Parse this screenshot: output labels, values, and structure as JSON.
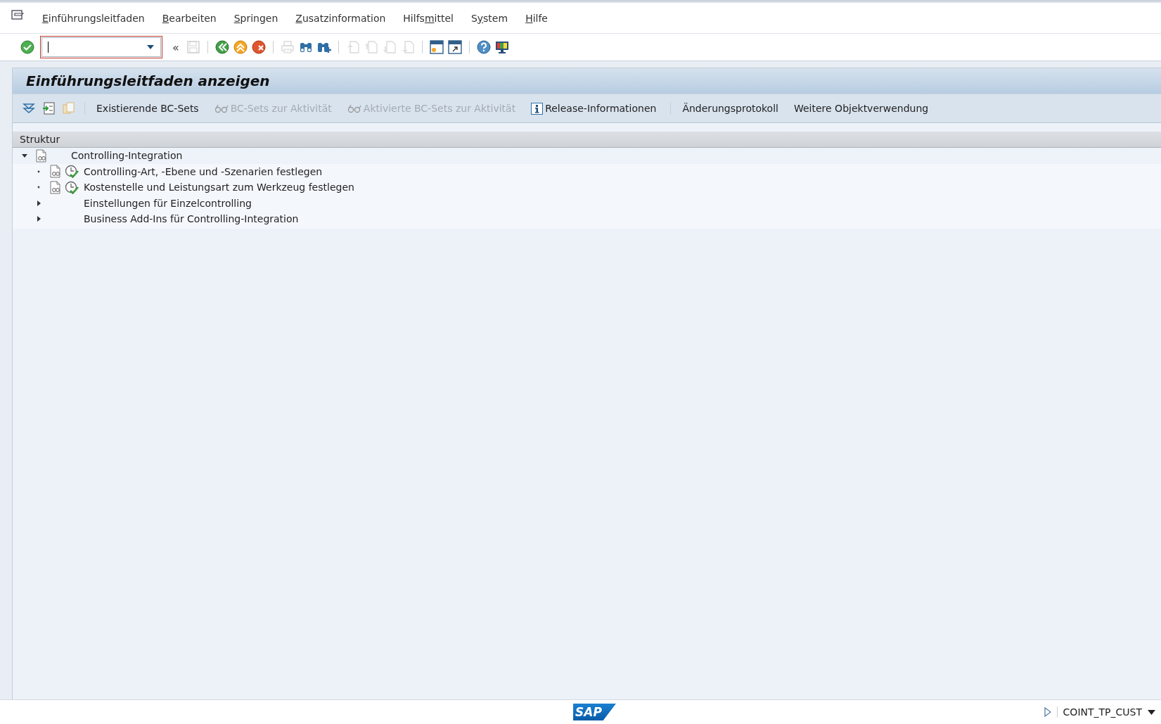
{
  "menu": [
    {
      "key": "E",
      "rest": "inführungsleitfaden"
    },
    {
      "key": "B",
      "rest": "earbeiten"
    },
    {
      "key": "S",
      "rest": "pringen"
    },
    {
      "key": "Z",
      "rest": "usatzinformation"
    },
    {
      "start": "Hilfs",
      "key": "m",
      "rest": "ittel"
    },
    {
      "start": "S",
      "key": "y",
      "rest": "stem"
    },
    {
      "key": "H",
      "rest": "ilfe"
    }
  ],
  "toolbar": [
    {
      "kind": "enter",
      "disabled": false
    },
    {
      "kind": "command"
    },
    {
      "kind": "history",
      "label": "«",
      "disabled": false
    },
    {
      "kind": "save",
      "disabled": true
    },
    {
      "kind": "sep"
    },
    {
      "kind": "back",
      "disabled": false
    },
    {
      "kind": "exit",
      "disabled": false
    },
    {
      "kind": "cancel",
      "disabled": false
    },
    {
      "kind": "sep"
    },
    {
      "kind": "print",
      "disabled": true
    },
    {
      "kind": "find",
      "disabled": false
    },
    {
      "kind": "findnext",
      "disabled": false
    },
    {
      "kind": "sep"
    },
    {
      "kind": "first",
      "disabled": true
    },
    {
      "kind": "prev",
      "disabled": true
    },
    {
      "kind": "next",
      "disabled": true
    },
    {
      "kind": "last",
      "disabled": true
    },
    {
      "kind": "sep"
    },
    {
      "kind": "newsession",
      "disabled": false
    },
    {
      "kind": "shortcut",
      "disabled": false
    },
    {
      "kind": "sep"
    },
    {
      "kind": "help",
      "disabled": false
    },
    {
      "kind": "layout",
      "disabled": false
    }
  ],
  "title": "Einführungsleitfaden anzeigen",
  "app_toolbar": [
    {
      "kind": "expand",
      "disabled": false
    },
    {
      "kind": "execute",
      "disabled": false
    },
    {
      "kind": "docs",
      "disabled": true
    },
    {
      "kind": "sep"
    },
    {
      "kind": "text",
      "label": "Existierende BC-Sets",
      "disabled": false
    },
    {
      "kind": "glasses",
      "label": "BC-Sets zur Aktivität",
      "disabled": true
    },
    {
      "kind": "glasses",
      "label": "Aktivierte BC-Sets zur Aktivität",
      "disabled": true
    },
    {
      "kind": "info",
      "label": "Release-Informationen",
      "disabled": false
    },
    {
      "kind": "sep"
    },
    {
      "kind": "text",
      "label": "Änderungsprotokoll",
      "disabled": false
    },
    {
      "kind": "text",
      "label": "Weitere Objektverwendung",
      "disabled": false
    }
  ],
  "tree": {
    "header": "Struktur",
    "items": [
      {
        "label": "Controlling-Integration",
        "kind": "structure",
        "expanded": true,
        "children": [
          {
            "label": "Controlling-Art, -Ebene und -Szenarien festlegen",
            "kind": "activity"
          },
          {
            "label": "Kostenstelle und Leistungsart zum Werkzeug festlegen",
            "kind": "activity"
          },
          {
            "label": "Einstellungen für Einzelcontrolling",
            "kind": "folder",
            "expanded": false
          },
          {
            "label": "Business Add-Ins für Controlling-Integration",
            "kind": "folder",
            "expanded": false
          }
        ]
      }
    ]
  },
  "status_bar": {
    "logo": "SAP",
    "transaction": "COINT_TP_CUST"
  }
}
